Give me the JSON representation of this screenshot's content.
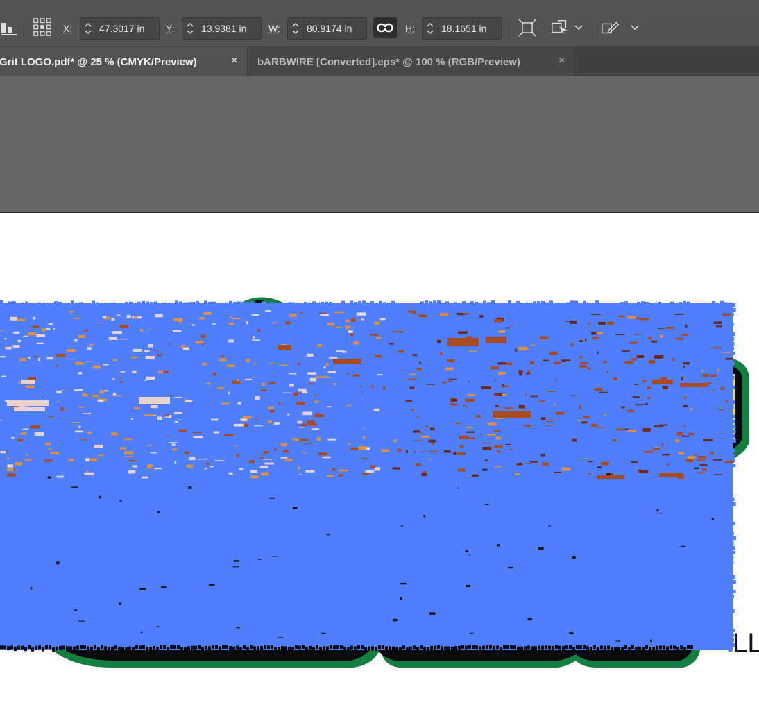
{
  "control_bar": {
    "x": {
      "label": "X:",
      "value": "47.3017 in"
    },
    "y": {
      "label": "Y:",
      "value": "13.9381 in"
    },
    "w": {
      "label": "W:",
      "value": "80.9174 in"
    },
    "h": {
      "label": "H:",
      "value": "18.1651 in"
    },
    "icons": [
      "align-bottom-icon",
      "reference-point-icon",
      "constrain-proportions-icon",
      "transform-icon",
      "shape-icon",
      "edit-path-icon"
    ]
  },
  "tabs": [
    {
      "title": "Grit LOGO.pdf* @ 25 % (CMYK/Preview)",
      "close": "×",
      "active": true
    },
    {
      "title": "bARBWIRE [Converted].eps* @ 100 % (RGB/Preview)",
      "close": "×",
      "active": false
    }
  ],
  "artwork": {
    "trailing_text": "LL",
    "colors": {
      "fill_blue": "#4f7fff",
      "outline_green": "#13803f",
      "outline_black": "#0b0b0b",
      "accent_yellow": "#f2e600",
      "rust": "#a84a22",
      "dark_brown": "#6a2a1e",
      "orange": "#e0903a",
      "pale_pink": "#e8d2d2"
    }
  }
}
